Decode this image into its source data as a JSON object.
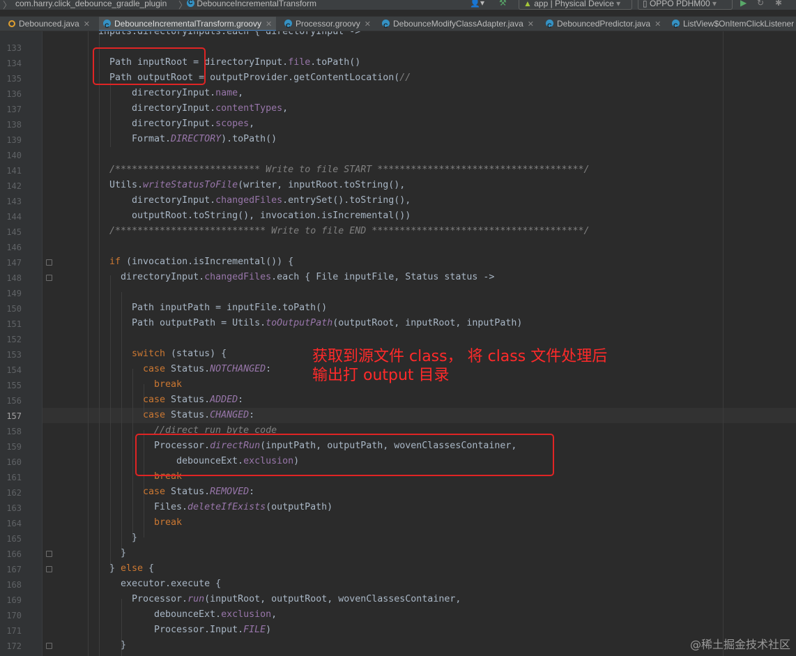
{
  "toolbar": {
    "breadcrumbs": [
      "com.harry.click_debounce_gradle_plugin",
      "DebounceIncrementalTransform"
    ],
    "run_config": "app | Physical Device",
    "device": "OPPO PDHM00"
  },
  "tabs": [
    {
      "label": "Debounced.java",
      "icon": "java-interface-icon"
    },
    {
      "label": "DebounceIncrementalTransform.groovy",
      "icon": "class-icon",
      "active": true
    },
    {
      "label": "Processor.groovy",
      "icon": "class-icon"
    },
    {
      "label": "DebounceModifyClassAdapter.java",
      "icon": "class-icon"
    },
    {
      "label": "DebouncedPredictor.java",
      "icon": "class-icon"
    },
    {
      "label": "ListView$OnItemClickListener",
      "icon": "class-icon"
    }
  ],
  "editor": {
    "current_line": 157,
    "lines": [
      {
        "n": "133"
      },
      {
        "n": "134"
      },
      {
        "n": "135"
      },
      {
        "n": "136"
      },
      {
        "n": "137"
      },
      {
        "n": "138"
      },
      {
        "n": "139"
      },
      {
        "n": "140"
      },
      {
        "n": "141"
      },
      {
        "n": "142"
      },
      {
        "n": "143"
      },
      {
        "n": "144"
      },
      {
        "n": "145"
      },
      {
        "n": "146"
      },
      {
        "n": "147"
      },
      {
        "n": "148"
      },
      {
        "n": "149"
      },
      {
        "n": "150"
      },
      {
        "n": "151"
      },
      {
        "n": "152"
      },
      {
        "n": "153"
      },
      {
        "n": "154"
      },
      {
        "n": "155"
      },
      {
        "n": "156"
      },
      {
        "n": "157"
      },
      {
        "n": "158"
      },
      {
        "n": "159"
      },
      {
        "n": "160"
      },
      {
        "n": "161"
      },
      {
        "n": "162"
      },
      {
        "n": "163"
      },
      {
        "n": "164"
      },
      {
        "n": "165"
      },
      {
        "n": "166"
      },
      {
        "n": "167"
      },
      {
        "n": "168"
      },
      {
        "n": "169"
      },
      {
        "n": "170"
      },
      {
        "n": "171"
      },
      {
        "n": "172"
      }
    ],
    "code": {
      "l132": "inputs.directoryInputs.each { directoryInput ->",
      "l134_a": "Path inputRoot = ",
      "l134_b": "directoryInput.",
      "l134_c": "file",
      "l134_d": ".toPath()",
      "l135_a": "Path outputRoot = outputProvider.getContentLocation(",
      "l135_b": "//",
      "l136_a": "directoryInput.",
      "l136_b": "name",
      "l136_c": ",",
      "l137_a": "directoryInput.",
      "l137_b": "contentTypes",
      "l137_c": ",",
      "l138_a": "directoryInput.",
      "l138_b": "scopes",
      "l138_c": ",",
      "l139_a": "Format.",
      "l139_b": "DIRECTORY",
      "l139_c": ").toPath()",
      "l141": "/************************** Write to file START *************************************/",
      "l142_a": "Utils.",
      "l142_b": "writeStatusToFile",
      "l142_c": "(writer, inputRoot.toString(),",
      "l143_a": "directoryInput.",
      "l143_b": "changedFiles",
      "l143_c": ".entrySet().toString(),",
      "l144": "outputRoot.toString(), invocation.isIncremental())",
      "l145": "/*************************** Write to file END **************************************/",
      "l147_a": "if",
      "l147_b": " (invocation.isIncremental()) {",
      "l148_a": "directoryInput.",
      "l148_b": "changedFiles",
      "l148_c": ".each { File inputFile, Status status ->",
      "l150": "Path inputPath = inputFile.toPath()",
      "l151_a": "Path outputPath = Utils.",
      "l151_b": "toOutputPath",
      "l151_c": "(outputRoot, inputRoot, inputPath)",
      "l153_a": "switch",
      "l153_b": " (status) {",
      "l154_a": "case",
      "l154_b": " Status.",
      "l154_c": "NOTCHANGED",
      "l154_d": ":",
      "l155": "break",
      "l156_a": "case",
      "l156_b": " Status.",
      "l156_c": "ADDED",
      "l156_d": ":",
      "l157_a": "case",
      "l157_b": " Status.",
      "l157_c": "CHANGED",
      "l157_d": ":",
      "l158": "//direct run byte code",
      "l159_a": "Processor.",
      "l159_b": "directRun",
      "l159_c": "(inputPath, outputPath, wovenClassesContainer,",
      "l160_a": "debounceExt.",
      "l160_b": "exclusion",
      "l160_c": ")",
      "l161": "break",
      "l162_a": "case",
      "l162_b": " Status.",
      "l162_c": "REMOVED",
      "l162_d": ":",
      "l163_a": "Files.",
      "l163_b": "deleteIfExists",
      "l163_c": "(outputPath)",
      "l164": "break",
      "l165": "}",
      "l166": "}",
      "l167_a": "} ",
      "l167_b": "else",
      "l167_c": " {",
      "l168": "executor.execute {",
      "l169_a": "Processor.",
      "l169_b": "run",
      "l169_c": "(inputRoot, outputRoot, wovenClassesContainer,",
      "l170_a": "debounceExt.",
      "l170_b": "exclusion",
      "l170_c": ",",
      "l171_a": "Processor.Input.",
      "l171_b": "FILE",
      "l171_c": ")",
      "l172": "}"
    }
  },
  "annotation": {
    "line1": "获取到源文件 class， 将 class 文件处理后",
    "line2": "输出打 output 目录"
  },
  "watermark": "@稀土掘金技术社区"
}
